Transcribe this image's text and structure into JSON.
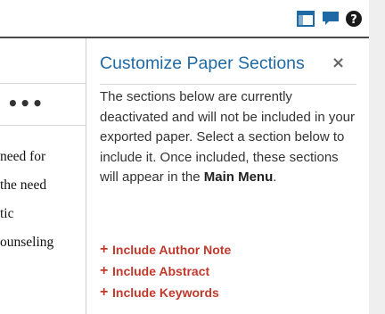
{
  "toolbar": {
    "icons": [
      "layout-icon",
      "chat-icon",
      "help-icon"
    ],
    "accent_color": "#1f6aa5"
  },
  "document": {
    "more_label": "•••",
    "lines": [
      "need for",
      "the need",
      "tic",
      "ounseling"
    ]
  },
  "panel": {
    "title": "Customize Paper Sections",
    "close_label": "×",
    "description_before": "The sections below are currently deactivated and will not be included in your exported paper. Select a section below to include it. Once included, these sections will appear in the ",
    "description_bold": "Main Menu",
    "description_after": ".",
    "include_items": [
      {
        "icon": "+",
        "label": "Include Author Note"
      },
      {
        "icon": "+",
        "label": "Include Abstract"
      },
      {
        "icon": "+",
        "label": "Include Keywords"
      }
    ],
    "link_color": "#c0392b"
  }
}
